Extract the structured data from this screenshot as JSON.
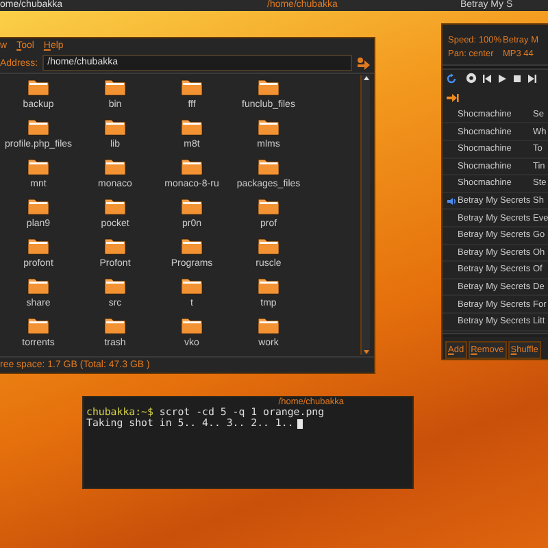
{
  "top_bar": {
    "left_title": "ome/chubakka",
    "center_title": "/home/chubakka",
    "right_title": "Betray My S"
  },
  "file_manager": {
    "menu": [
      {
        "label": "w",
        "mnemonic": false
      },
      {
        "label": "Tool",
        "mnemonic": true
      },
      {
        "label": "Help",
        "mnemonic": true
      }
    ],
    "address_label": "Address:",
    "address": "/home/chubakka",
    "folders": [
      "backup",
      "bin",
      "fff",
      "funclub_files",
      "profile.php_files",
      "lib",
      "m8t",
      "mlms",
      "mnt",
      "monaco",
      "monaco-8-ru",
      "packages_files",
      "plan9",
      "pocket",
      "pr0n",
      "prof",
      "profont",
      "Profont",
      "Programs",
      "ruscle",
      "share",
      "src",
      "t",
      "tmp",
      "torrents",
      "trash",
      "vko",
      "work"
    ],
    "status": "ree space: 1.7 GB (Total: 47.3 GB )"
  },
  "player": {
    "info": [
      {
        "left": "Speed: 100%",
        "right": "Betray M"
      },
      {
        "left": "Pan: center",
        "right": "MP3 44"
      }
    ],
    "tracks": [
      {
        "artist": "Shocmachine",
        "title": "Se",
        "playing": false
      },
      {
        "artist": "Shocmachine",
        "title": "Wh",
        "playing": false
      },
      {
        "artist": "Shocmachine",
        "title": "To",
        "playing": false
      },
      {
        "artist": "Shocmachine",
        "title": "Tin",
        "playing": false
      },
      {
        "artist": "Shocmachine",
        "title": "Ste",
        "playing": false
      },
      {
        "artist": "Betray My Secrets",
        "title": "Sh",
        "playing": true
      },
      {
        "artist": "Betray My Secrets",
        "title": "Eve",
        "playing": false
      },
      {
        "artist": "Betray My Secrets",
        "title": "Go",
        "playing": false
      },
      {
        "artist": "Betray My Secrets",
        "title": "Oh",
        "playing": false
      },
      {
        "artist": "Betray My Secrets",
        "title": "Of",
        "playing": false
      },
      {
        "artist": "Betray My Secrets",
        "title": "De",
        "playing": false
      },
      {
        "artist": "Betray My Secrets",
        "title": "For",
        "playing": false
      },
      {
        "artist": "Betray My Secrets",
        "title": "Litt",
        "playing": false
      }
    ],
    "buttons": [
      "Add",
      "Remove",
      "Shuffle"
    ]
  },
  "terminal": {
    "title": "/home/chubakka",
    "prompt": "chubakka:~$",
    "command": "scrot -cd 5 -q 1 orange.png",
    "output": "Taking shot in 5.. 4.. 3.. 2.. 1.."
  }
}
